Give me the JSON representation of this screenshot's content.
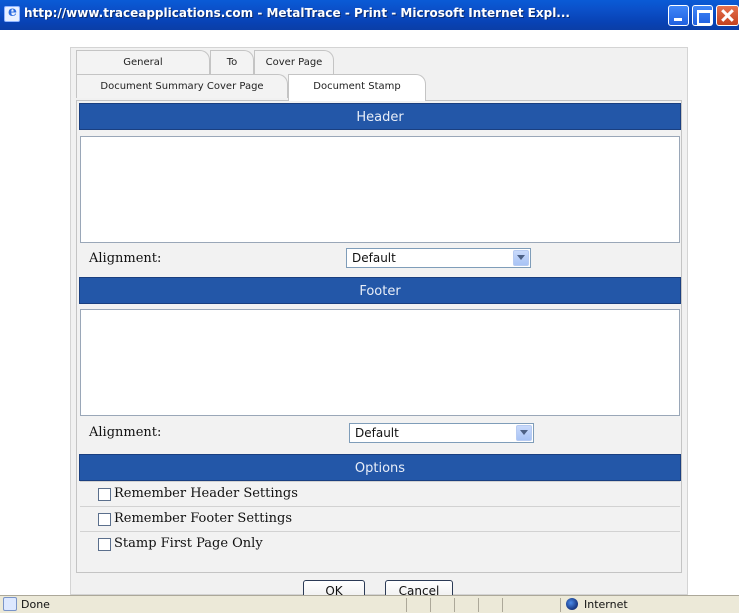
{
  "window": {
    "title": "http://www.traceapplications.com - MetalTrace - Print - Microsoft Internet Expl..."
  },
  "tabs": {
    "general": "General",
    "to": "To",
    "cover_page": "Cover Page",
    "document_summary_cover_page": "Document Summary Cover Page",
    "document_stamp": "Document Stamp"
  },
  "header": {
    "title": "Header",
    "text": "",
    "alignment_label": "Alignment:",
    "alignment_value": "Default"
  },
  "footer": {
    "title": "Footer",
    "text": "",
    "alignment_label": "Alignment:",
    "alignment_value": "Default"
  },
  "options": {
    "title": "Options",
    "items": [
      {
        "label": "Remember Header Settings",
        "checked": false
      },
      {
        "label": "Remember Footer Settings",
        "checked": false
      },
      {
        "label": "Stamp First Page Only",
        "checked": false
      }
    ]
  },
  "buttons": {
    "ok": "OK",
    "cancel": "Cancel"
  },
  "statusbar": {
    "status": "Done",
    "zone": "Internet"
  },
  "icons": {
    "window": "ie-page-icon",
    "zone": "globe-icon"
  }
}
